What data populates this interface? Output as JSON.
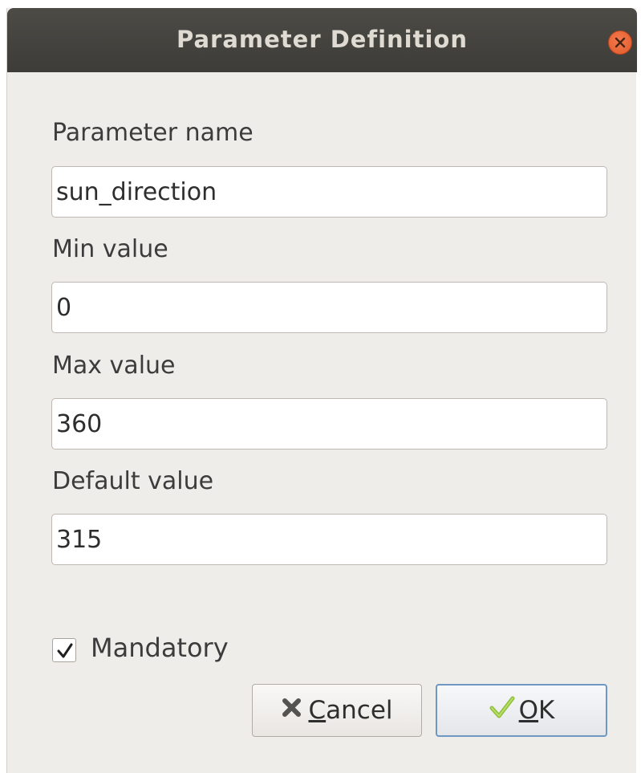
{
  "window": {
    "title": "Parameter Definition"
  },
  "form": {
    "parameter_name": {
      "label": "Parameter name",
      "value": "sun_direction"
    },
    "min_value": {
      "label": "Min value",
      "value": "0"
    },
    "max_value": {
      "label": "Max value",
      "value": "360"
    },
    "default_value": {
      "label": "Default value",
      "value": "315"
    },
    "mandatory": {
      "label": "Mandatory",
      "checked": true
    }
  },
  "buttons": {
    "cancel": {
      "mnemonic": "C",
      "rest": "ancel",
      "icon": "x-icon"
    },
    "ok": {
      "mnemonic": "O",
      "rest": "K",
      "icon": "check-icon"
    }
  },
  "colors": {
    "titlebar": "#3d3c38",
    "close_button": "#e9622f",
    "window_bg": "#efedea",
    "ok_border": "#6f97c3"
  }
}
